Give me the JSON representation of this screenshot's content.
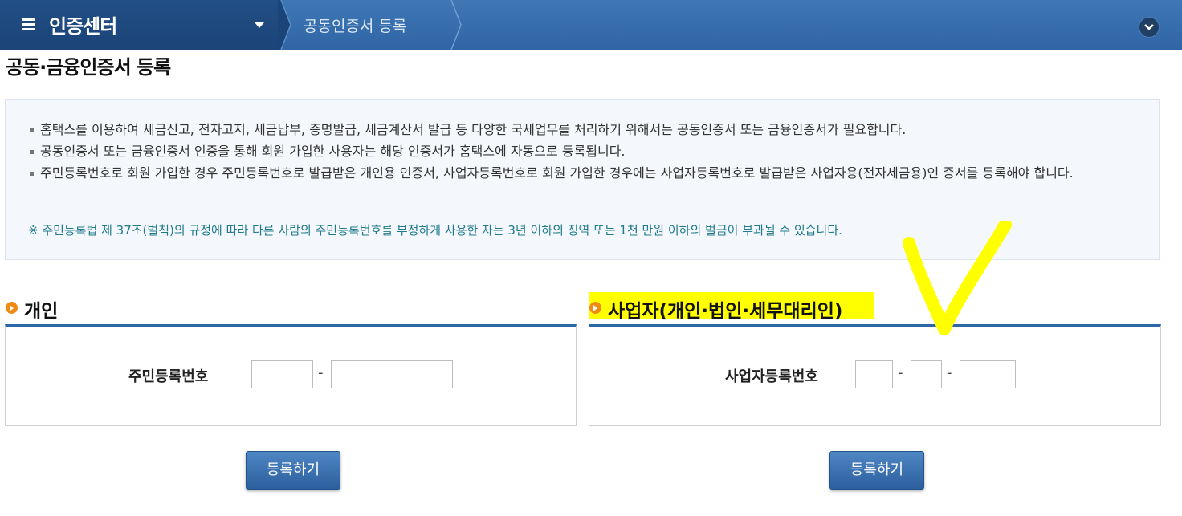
{
  "header": {
    "home_title": "인증센터",
    "breadcrumb": "공동인증서 등록",
    "colors": {
      "bar": "#2f65a5",
      "home": "#1b4478"
    }
  },
  "page": {
    "title": "공동·금융인증서 등록"
  },
  "notice": {
    "items": [
      "홈택스를 이용하여 세금신고, 전자고지, 세금납부, 증명발급, 세금계산서 발급 등 다양한 국세업무를 처리하기 위해서는 공동인증서 또는 금융인증서가 필요합니다.",
      "공동인증서 또는 금융인증서 인증을 통해 회원 가입한 사용자는 해당 인증서가 홈택스에 자동으로 등록됩니다.",
      "주민등록번호로 회원 가입한 경우 주민등록번호로 발급받은 개인용 인증서, 사업자등록번호로 회원 가입한 경우에는 사업자등록번호로 발급받은 사업자용(전자세금용)인 증서를 등록해야 합니다."
    ],
    "warning": "※ 주민등록법 제 37조(벌칙)의 규정에 따라 다른 사람의 주민등록번호를 부정하게 사용한 자는 3년 이하의 징역 또는 1천 만원 이하의 벌금이 부과될 수 있습니다."
  },
  "personal": {
    "heading": "개인",
    "field_label": "주민등록번호",
    "part1": "",
    "part2": "",
    "button": "등록하기"
  },
  "business": {
    "heading": "사업자(개인·법인·세무대리인)",
    "field_label": "사업자등록번호",
    "part1": "",
    "part2": "",
    "part3": "",
    "button": "등록하기"
  },
  "separator": "-",
  "annotation": {
    "highlight_color": "#ffff00"
  }
}
